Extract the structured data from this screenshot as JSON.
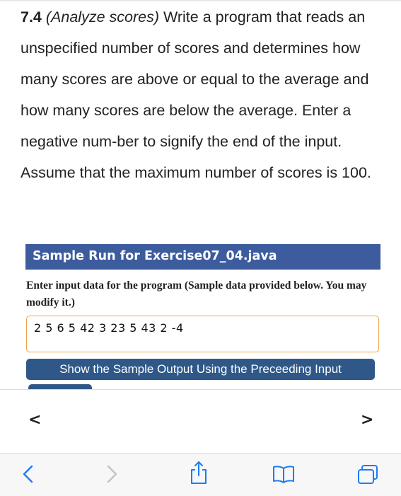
{
  "exercise": {
    "number": "7.4",
    "subtitle": "(Analyze scores)",
    "text": "Write a program that reads an unspecified number of scores and determines how many scores are above or equal to the average and how many scores are below the average. Enter a negative num-ber to signify the end of the input. Assume that the maximum number of scores is 100."
  },
  "sample_run": {
    "title": "Sample Run for Exercise07_04.java",
    "instructions": "Enter input data for the program (Sample data provided below. You may modify it.)",
    "input_value": "2 5 6 5 42 3 23 5 43 2 -4",
    "show_button_label": "Show the Sample Output Using the Preceeding Input"
  },
  "page_nav": {
    "prev_label": "<",
    "next_label": ">"
  },
  "toolbar": {
    "icons": [
      "back-icon",
      "forward-icon",
      "share-icon",
      "bookmarks-icon",
      "tabs-icon"
    ],
    "accent_color": "#1a7cf5"
  },
  "colors": {
    "panel_header": "#3d5c9e",
    "button": "#2f5889",
    "input_border": "#f0a44a"
  }
}
